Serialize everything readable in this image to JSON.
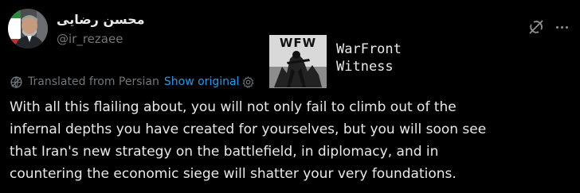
{
  "author": {
    "display_name": "محسن رضایی",
    "handle": "@ir_rezaee"
  },
  "watermark": {
    "logo_text": "WFW",
    "line1": "WarFront",
    "line2": "Witness"
  },
  "translation": {
    "translated_label": "Translated from Persian",
    "show_original_label": "Show original"
  },
  "tweet": {
    "lines": [
      "With all this flailing about, you will not only fail to climb out of the",
      "infernal depths you have created for yourselves, but you will soon see",
      "that Iran's new strategy on the battlefield, in diplomacy, and in",
      "countering the economic siege will shatter your very foundations."
    ]
  },
  "icons": {
    "top_right": [
      "grok-icon",
      "more-icon"
    ],
    "translation": [
      "globe-icon",
      "gear-icon"
    ]
  },
  "colors": {
    "background": "#000000",
    "primary_text": "#e7e9ea",
    "secondary_text": "#71767b",
    "link": "#1d9bf0"
  }
}
